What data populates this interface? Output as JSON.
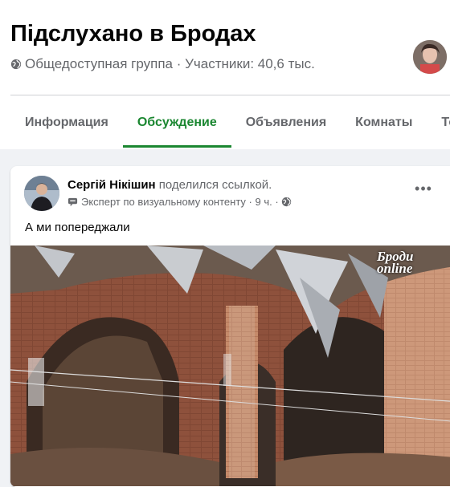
{
  "group": {
    "title": "Підслухано в Бродах",
    "meta": "Общедоступная группа · Участники: 40,6 тыс."
  },
  "tabs": [
    {
      "label": "Информация",
      "active": false
    },
    {
      "label": "Обсуждение",
      "active": true
    },
    {
      "label": "Объявления",
      "active": false
    },
    {
      "label": "Комнаты",
      "active": false
    },
    {
      "label": "Те",
      "active": false
    }
  ],
  "post": {
    "author": "Сергій Нікішин",
    "action": "поделился ссылкой.",
    "badge": "Эксперт по визуальному контенту",
    "time": "9 ч.",
    "text": "А ми попереджали",
    "more_label": "•••",
    "watermark_line1": "Броди",
    "watermark_line2": "online"
  },
  "colors": {
    "accent": "#1b8731",
    "secondary_text": "#65676b",
    "background": "#f0f2f5"
  },
  "icons": [
    "globe-icon",
    "expert-badge-icon",
    "globe-small-icon",
    "more-options-icon"
  ]
}
